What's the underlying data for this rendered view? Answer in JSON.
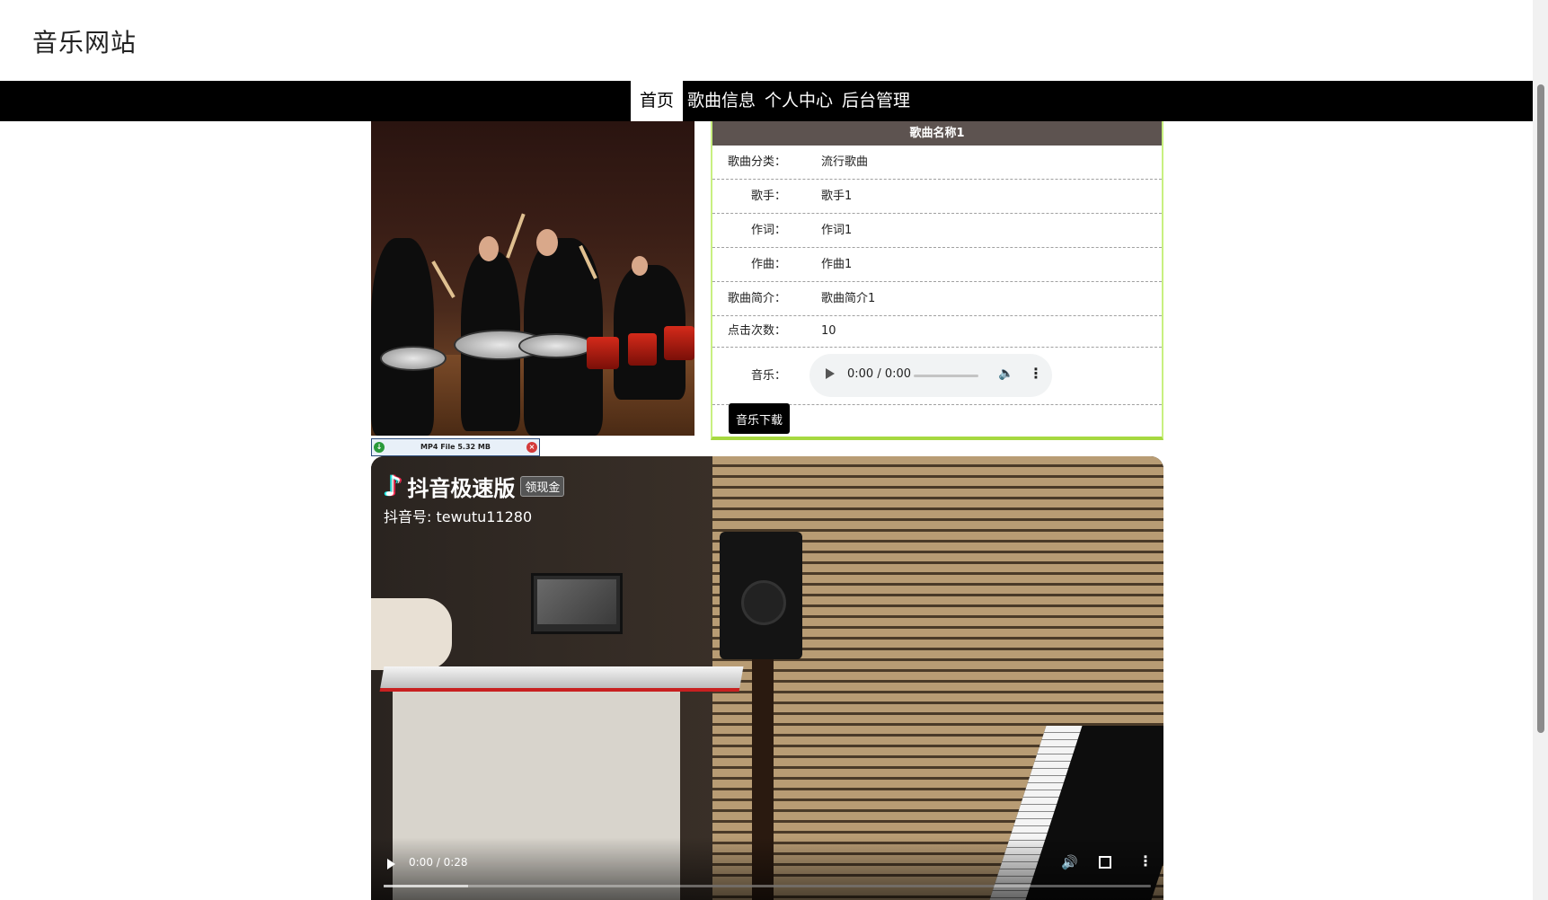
{
  "site": {
    "title": "音乐网站"
  },
  "nav": {
    "items": [
      "首页",
      "歌曲信息",
      "个人中心",
      "后台管理"
    ],
    "active_index": 0
  },
  "song": {
    "title": "歌曲名称1",
    "fields": [
      {
        "label": "歌曲分类：",
        "value": "流行歌曲"
      },
      {
        "label": "歌手：",
        "value": "歌手1"
      },
      {
        "label": "作词：",
        "value": "作词1"
      },
      {
        "label": "作曲：",
        "value": "作曲1"
      },
      {
        "label": "歌曲简介：",
        "value": "歌曲简介1"
      },
      {
        "label": "点击次数：",
        "value": "10"
      }
    ],
    "music_label": "音乐：",
    "audio": {
      "time": "0:00 / 0:00"
    },
    "download_label": "音乐下载"
  },
  "file_badge": {
    "text": "MP4 File 5.32 MB"
  },
  "video": {
    "app_name": "抖音极速版",
    "tag": "领现金",
    "account": "抖音号: tewutu11280",
    "time": "0:00 / 0:28",
    "buffered": 0.11
  },
  "colors": {
    "nav_bg": "#000000",
    "panel_title_bg": "#5d5350",
    "panel_border": "#a6d840"
  },
  "icons": [
    "play-icon",
    "volume-icon",
    "more-icon",
    "fullscreen-icon",
    "tiktok-icon"
  ]
}
